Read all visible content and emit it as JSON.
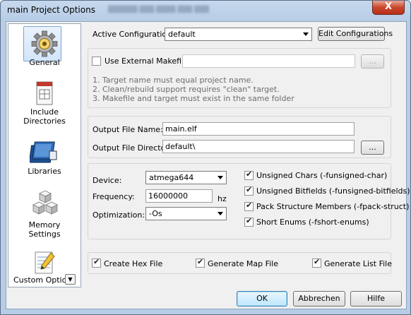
{
  "window": {
    "title": "main Project Options",
    "close_glyph": "X"
  },
  "sidebar": {
    "items": [
      {
        "label_lines": [
          "General"
        ],
        "icon": "gear-icon",
        "selected": true
      },
      {
        "label_lines": [
          "Include",
          "Directories"
        ],
        "icon": "include-directories-icon",
        "selected": false
      },
      {
        "label_lines": [
          "Libraries"
        ],
        "icon": "libraries-icon",
        "selected": false
      },
      {
        "label_lines": [
          "Memory",
          "Settings"
        ],
        "icon": "memory-settings-icon",
        "selected": false
      },
      {
        "label_lines": [
          "Custom Options"
        ],
        "icon": "notepad-icon",
        "selected": false
      }
    ],
    "scroll_glyph": "▼"
  },
  "config": {
    "label": "Active Configuration",
    "value": "default",
    "edit_button": "Edit Configurations"
  },
  "makefile": {
    "checkbox_label": "Use External Makefile",
    "checked": false,
    "path_value": "",
    "browse_label": "...",
    "hints": [
      "1. Target name must equal project name.",
      "2. Clean/rebuild support requires  \"clean\" target.",
      "3. Makefile and target must exist in the same folder"
    ]
  },
  "output": {
    "file_name_label": "Output File Name:",
    "file_name_value": "main.elf",
    "dir_label": "Output File Directory:",
    "dir_value": "default\\",
    "browse_label": "..."
  },
  "device": {
    "device_label": "Device:",
    "device_value": "atmega644",
    "frequency_label": "Frequency:",
    "frequency_value": "16000000",
    "frequency_unit": "hz",
    "optimization_label": "Optimization:",
    "optimization_value": "-Os"
  },
  "flags": [
    {
      "label": "Unsigned Chars (-funsigned-char)",
      "checked": true
    },
    {
      "label": "Unsigned Bitfields (-funsigned-bitfields)",
      "checked": true
    },
    {
      "label": "Pack Structure Members (-fpack-struct)",
      "checked": true
    },
    {
      "label": "Short Enums (-fshort-enums)",
      "checked": true
    }
  ],
  "outputs": [
    {
      "label": "Create Hex File",
      "checked": true
    },
    {
      "label": "Generate Map File",
      "checked": true
    },
    {
      "label": "Generate List File",
      "checked": true
    }
  ],
  "buttons": {
    "ok": "OK",
    "cancel": "Abbrechen",
    "help": "Hilfe"
  }
}
